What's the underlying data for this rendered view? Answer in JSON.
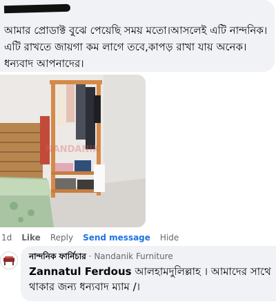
{
  "comment": {
    "text": "আমার প্রোডাক্ট বুঝে পেয়েছি সময় মতো।আসলেই এটি নান্দনিক।এটি রাখতে জায়গা কম লাগে তবে,কাপড় রাখা যায় অনেক।ধন্যবাদ আপনাদের।",
    "photo": {
      "watermark": "NANDANIK",
      "description_icon": "image-icon"
    },
    "actions": {
      "time": "1d",
      "like": "Like",
      "reply": "Reply",
      "send_message": "Send message",
      "hide": "Hide"
    }
  },
  "reply": {
    "author": "নান্দনিক ফার্নিচার",
    "separator": "·",
    "page_name": "Nandanik Furniture",
    "mention": "Zannatul Ferdous",
    "text": "আলহামদুলিল্লাহ । আমাদের সাথে থাকার জন্য ধন্যবাদ ম্যাম /।"
  },
  "colors": {
    "bubble": "#f0f2f5",
    "link_blue": "#1b74e4",
    "muted": "#65676b"
  }
}
